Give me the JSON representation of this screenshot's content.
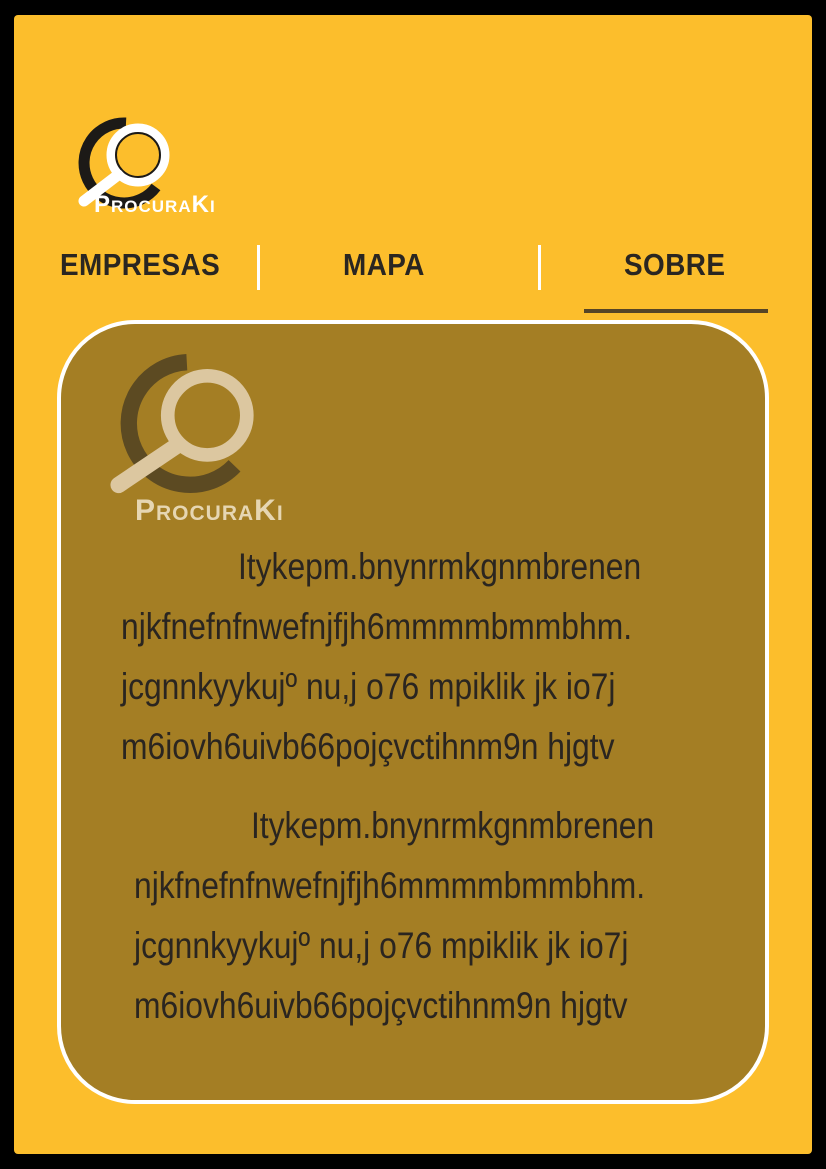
{
  "header": {
    "logo_text": "ProcuraKi"
  },
  "nav": {
    "tabs": [
      {
        "label": "EMPRESAS"
      },
      {
        "label": "MAPA"
      },
      {
        "label": "SOBRE",
        "active": true
      }
    ]
  },
  "card": {
    "logo_text": "ProcuraKi",
    "paragraphs": [
      {
        "lines": [
          "Itykepm.bnynrmkgnmbrenen",
          "njkfnefnfnwefnjfjh6mmmmbmmbhm.",
          "jcgnnkyykujº nu,j o76 mpiklik jk io7j",
          "m6iovh6uivb66pojçvctihnm9n hjgtv"
        ]
      },
      {
        "lines": [
          "Itykepm.bnynrmkgnmbrenen",
          "njkfnefnfnwefnjfjh6mmmmbmmbhm.",
          "jcgnnkyykujº nu,j o76 mpiklik jk io7j",
          "m6iovh6uivb66pojçvctihnm9n hjgtv"
        ]
      }
    ]
  },
  "colors": {
    "background": "#fcbe2c",
    "card": "#a47e24",
    "text": "#2a2520",
    "active_underline": "#564526"
  },
  "icons": [
    "magnifier-logo-icon"
  ]
}
